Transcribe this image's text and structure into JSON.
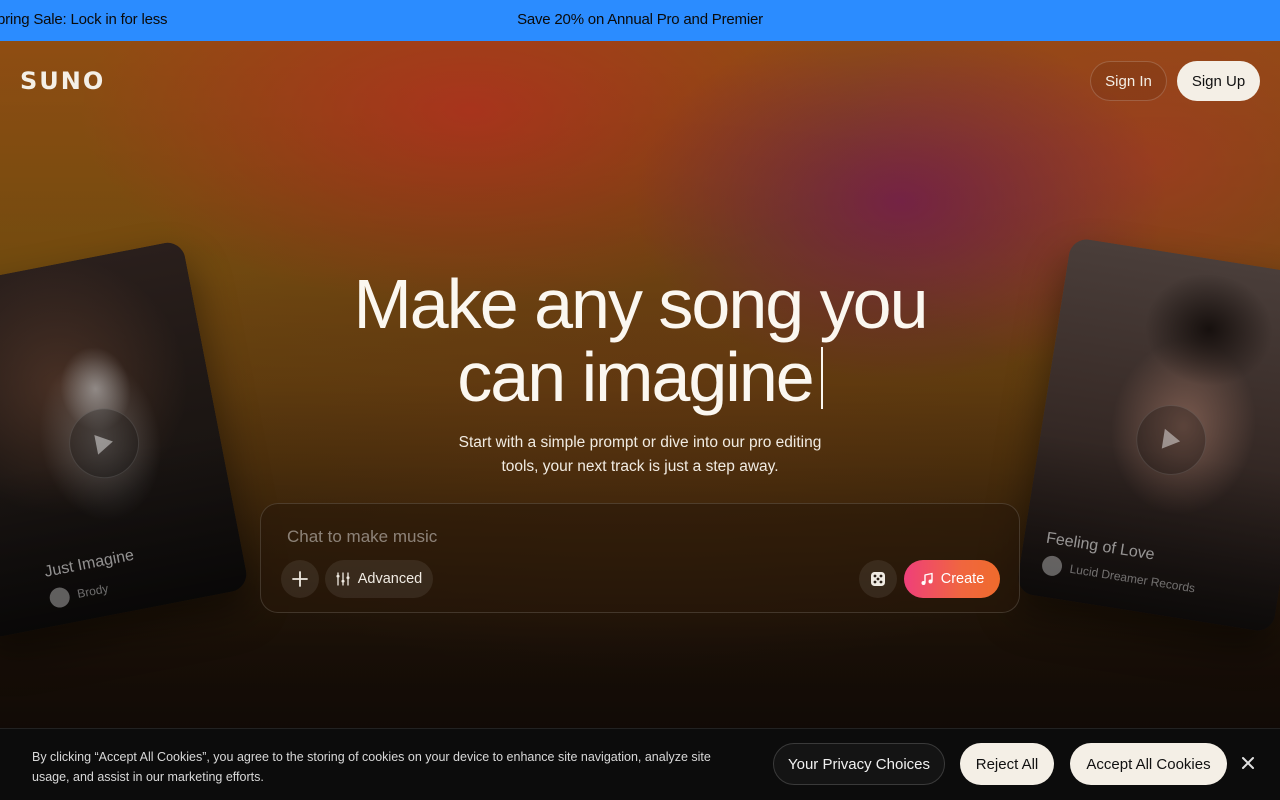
{
  "promo": {
    "left_text": "pring Sale: Lock in for less",
    "center_text": "Save 20% on Annual Pro and Premier",
    "color": "#2b8cff"
  },
  "header": {
    "logo": "SUNO",
    "sign_in": "Sign In",
    "sign_up": "Sign Up"
  },
  "hero": {
    "headline_line1": "Make any song you",
    "headline_line2": "can imagine",
    "subtitle": "Start with a simple prompt or dive into our pro editing tools, your next track is just a step away."
  },
  "prompt": {
    "placeholder": "Chat to make music",
    "advanced_label": "Advanced",
    "create_label": "Create",
    "create_gradient": [
      "#ef3f7a",
      "#ef6b2c"
    ]
  },
  "cards": [
    {
      "title": "Just Imagine",
      "artist": "Brody"
    },
    {
      "title": "Feeling of Love",
      "artist": "Lucid Dreamer Records"
    }
  ],
  "cookie": {
    "text": "By clicking “Accept All Cookies”, you agree to the storing of cookies on your device to enhance site navigation, analyze site usage, and assist in our marketing efforts.",
    "privacy_choices": "Your Privacy Choices",
    "reject_all": "Reject All",
    "accept_all": "Accept All Cookies"
  },
  "icons": {
    "add": "plus-icon",
    "advanced": "sliders-icon",
    "dice": "dice-icon",
    "create": "music-note-icon",
    "play": "play-icon",
    "close": "close-icon"
  }
}
